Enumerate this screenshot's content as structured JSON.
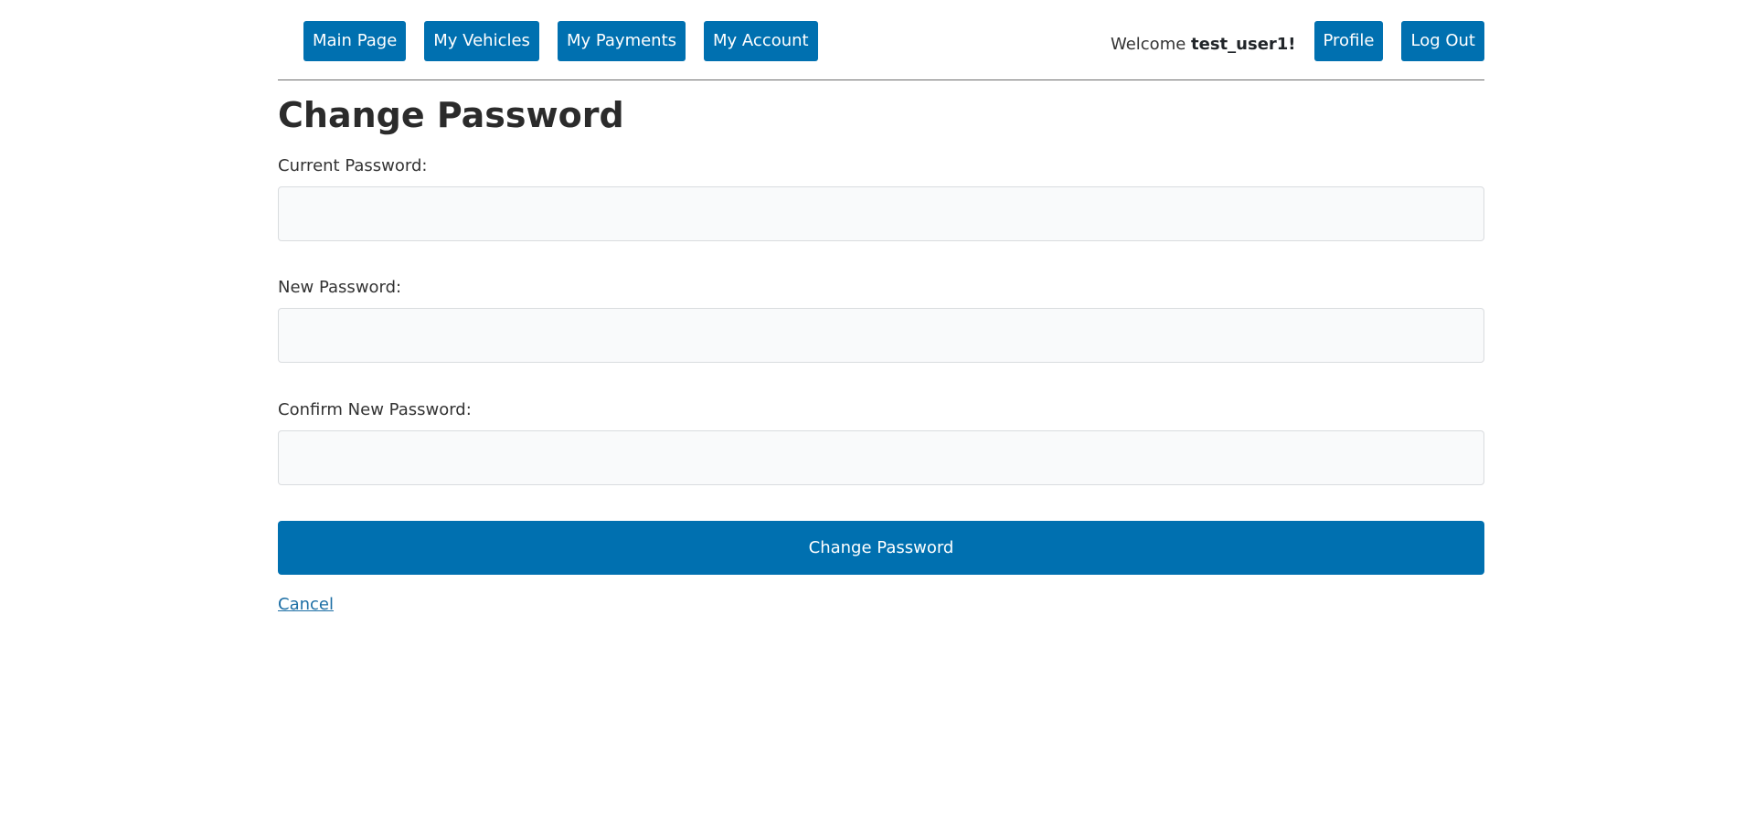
{
  "nav": {
    "main_page": "Main Page",
    "my_vehicles": "My Vehicles",
    "my_payments": "My Payments",
    "my_account": "My Account",
    "welcome_prefix": "Welcome ",
    "username": "test_user1!",
    "profile": "Profile",
    "log_out": "Log Out"
  },
  "page": {
    "title": "Change Password"
  },
  "form": {
    "current_password_label": "Current Password:",
    "current_password_value": "",
    "new_password_label": "New Password:",
    "new_password_value": "",
    "confirm_password_label": "Confirm New Password:",
    "confirm_password_value": "",
    "submit_label": "Change Password",
    "cancel_label": "Cancel"
  },
  "colors": {
    "primary": "#0070b0",
    "link": "#1d6fa5",
    "input_bg": "#f9fafb"
  }
}
